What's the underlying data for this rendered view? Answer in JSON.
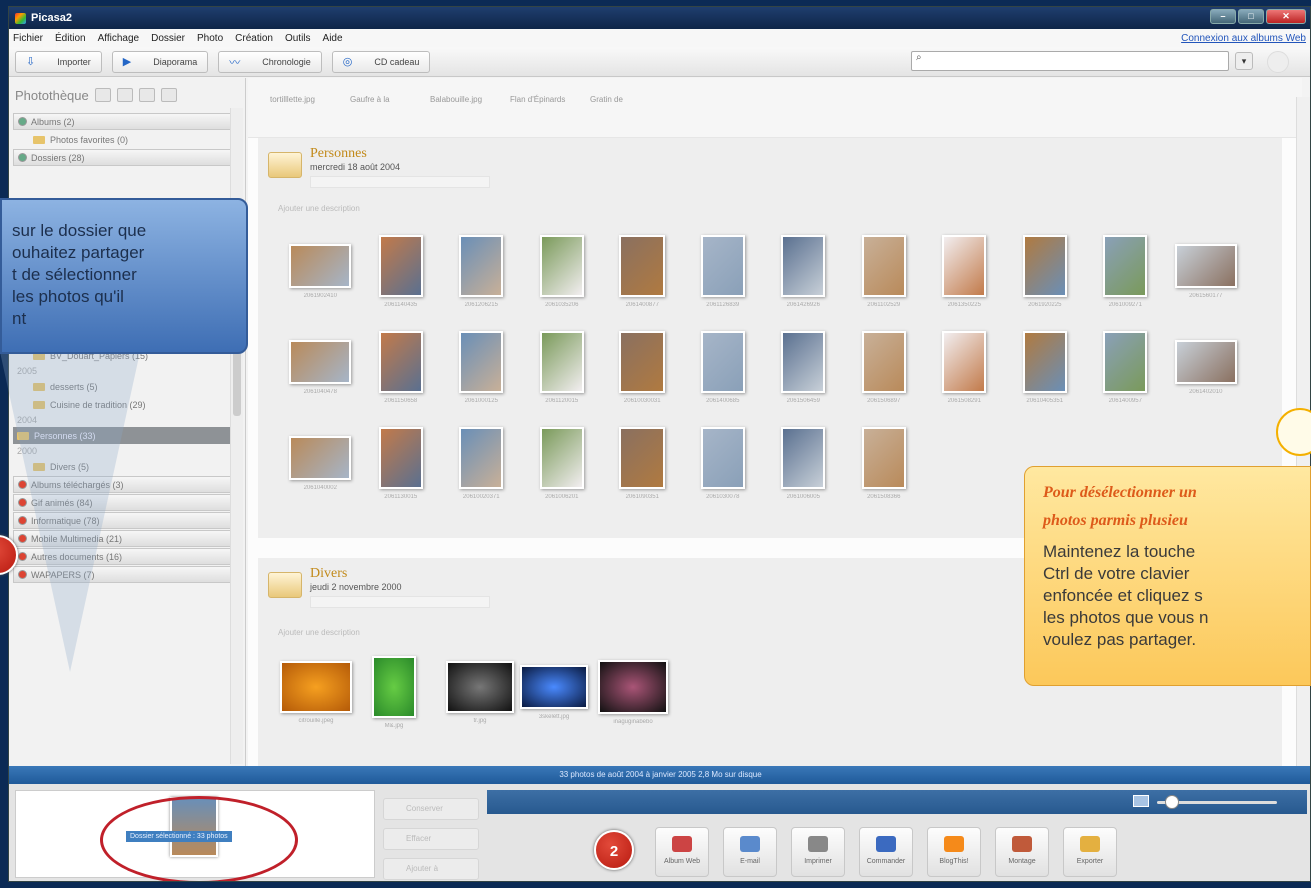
{
  "window": {
    "title": "Picasa2"
  },
  "menu": {
    "items": [
      "Fichier",
      "Édition",
      "Affichage",
      "Dossier",
      "Photo",
      "Création",
      "Outils",
      "Aide"
    ],
    "link": "Connexion aux albums Web"
  },
  "toolbar": {
    "buttons": [
      "Importer",
      "Diaporama",
      "Chronologie",
      "CD cadeau"
    ],
    "search_placeholder": ""
  },
  "sidebar": {
    "title": "Photothèque",
    "rows": [
      {
        "label": "Albums (2)",
        "type": "sec",
        "bul": "green"
      },
      {
        "label": "Photos favorites (0)",
        "type": "sub"
      },
      {
        "label": "Dossiers (28)",
        "type": "sec",
        "bul": "green"
      },
      {
        "label": "",
        "type": "spacer"
      },
      {
        "label": "",
        "type": "spacer"
      },
      {
        "label": "",
        "type": "spacer"
      },
      {
        "label": "",
        "type": "spacer"
      },
      {
        "label": "",
        "type": "spacer"
      },
      {
        "label": "",
        "type": "spacer"
      },
      {
        "label": "",
        "type": "spacer"
      },
      {
        "label": "",
        "type": "spacer"
      },
      {
        "label": "",
        "type": "spacer"
      },
      {
        "label": "BV_Douart_Accessoires (17)",
        "type": "sub"
      },
      {
        "label": "BV_Douart_Papiers (15)",
        "type": "sub"
      },
      {
        "label": "2005",
        "type": "year"
      },
      {
        "label": "desserts (5)",
        "type": "sub"
      },
      {
        "label": "Cuisine de tradition (29)",
        "type": "sub"
      },
      {
        "label": "2004",
        "type": "year"
      },
      {
        "label": "Personnes (33)",
        "type": "sel"
      },
      {
        "label": "2000",
        "type": "year"
      },
      {
        "label": "Divers (5)",
        "type": "sub"
      },
      {
        "label": "Albums téléchargés (3)",
        "type": "sec",
        "bul": "red"
      },
      {
        "label": "Gif animés (84)",
        "type": "sec",
        "bul": "red"
      },
      {
        "label": "Informatique (78)",
        "type": "sec",
        "bul": "red"
      },
      {
        "label": "Mobile Multimedia (21)",
        "type": "sec",
        "bul": "red"
      },
      {
        "label": "Autres documents (16)",
        "type": "sec",
        "bul": "red"
      },
      {
        "label": "WAPAPERS (7)",
        "type": "sec",
        "bul": "red"
      }
    ]
  },
  "top_strip": {
    "captions": [
      "tortilllette.jpg",
      "Gaufre à la",
      "Balabouille.jpg",
      "Flan d'Épinards",
      "Gratin de"
    ]
  },
  "albums": [
    {
      "name": "Personnes",
      "date": "mercredi 18 août 2004",
      "placeholder": "Ajouter une description"
    },
    {
      "name": "Divers",
      "date": "jeudi 2 novembre 2000",
      "placeholder": "Ajouter une description"
    }
  ],
  "personnes_thumbs": [
    "2061902410",
    "2061140435",
    "2061206215",
    "2061035206",
    "2061400877",
    "2061126839",
    "2061426926",
    "2061102529",
    "2061350225",
    "2061920225",
    "2061009271",
    "2061560177",
    "2061040478",
    "2061150658",
    "2061000125",
    "2061120015",
    "20610030031",
    "2061400685",
    "2061506459",
    "2061506897",
    "2061508291",
    "20610405351",
    "2061400957",
    "2061402010",
    "2061040002",
    "2061130015",
    "20610020371",
    "2061006201",
    "2061090351",
    "2061030078",
    "2061006005",
    "2061508366"
  ],
  "divers_thumbs": [
    "citrouille.jpeg",
    "M&.jpg",
    "tr.jpg",
    "3skelett.jpg",
    "inaguginabebo"
  ],
  "status": {
    "text": "33 photos     de août 2004     à janvier 2005     2,8 Mo sur disque"
  },
  "tray": {
    "label": "Dossier sélectionné : 33 photos",
    "actions": [
      "Conserver",
      "Effacer",
      "Ajouter à"
    ]
  },
  "share": {
    "buttons": [
      "Album Web",
      "E-mail",
      "Imprimer",
      "Commander",
      "BlogThis!",
      "Montage",
      "Exporter"
    ]
  },
  "callouts": {
    "step1_lines": [
      "sur le dossier que",
      "ouhaitez partager",
      "t de sélectionner",
      "les photos qu'il",
      "nt"
    ],
    "step2_number": "2",
    "tip_title_1": "Pour désélectionner un",
    "tip_title_2": "photos parmis plusieu",
    "tip_body_lines": [
      "Maintenez la touche",
      "Ctrl de votre clavier",
      "enfoncée et cliquez s",
      "les photos que vous n",
      "voulez pas partager."
    ]
  },
  "colors": {
    "accent": "#3b74b4",
    "selected": "#8e9296",
    "tip_title": "#dd5a1a",
    "marker": "#c0202a"
  }
}
